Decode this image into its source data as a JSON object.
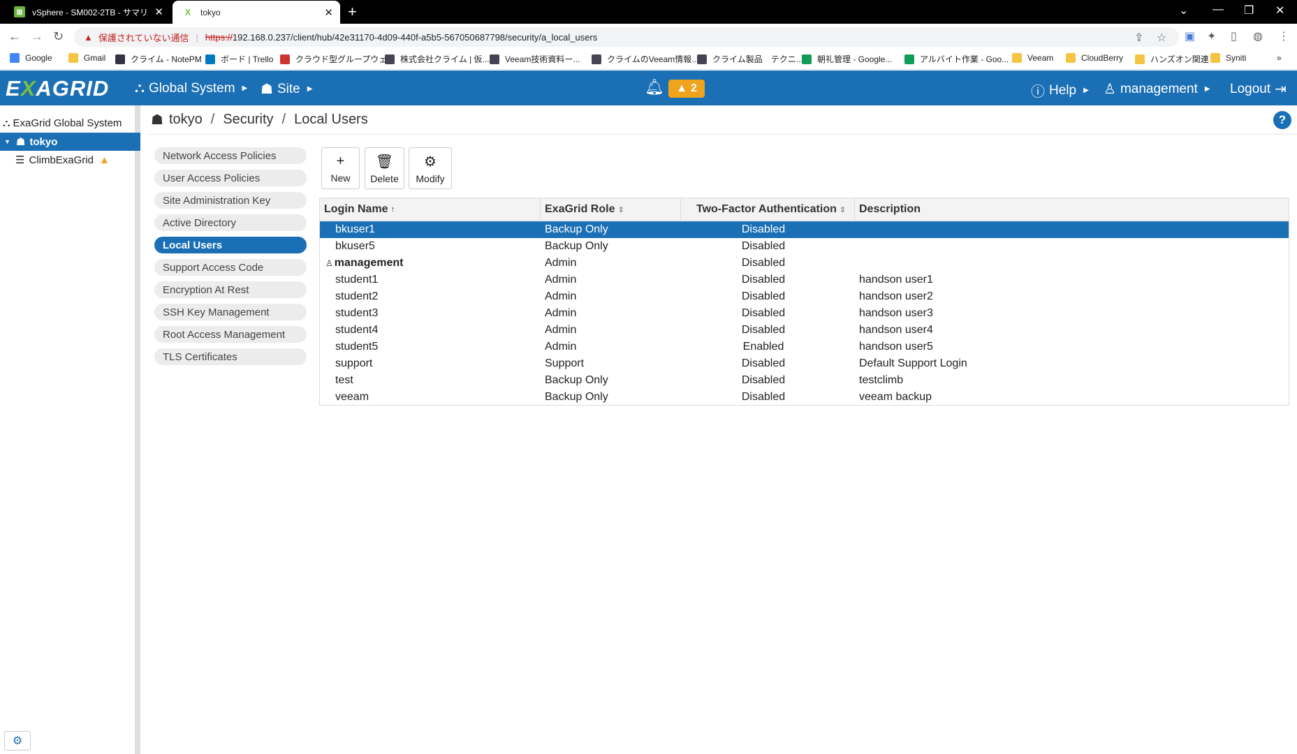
{
  "browser": {
    "tabs": [
      {
        "title": "vSphere - SM002-2TB - サマリ"
      },
      {
        "title": "tokyo"
      }
    ],
    "address": {
      "insecure_label": "保護されていない通信",
      "scheme": "https://",
      "url_rest": "192.168.0.237/client/hub/42e31170-4d09-440f-a5b5-567050687798/security/a_local_users"
    },
    "bookmarks": [
      {
        "label": "Google",
        "color": "#4285f4"
      },
      {
        "label": "Gmail",
        "color": "#f4c542"
      },
      {
        "label": "クライム - NotePM",
        "color": "#334"
      },
      {
        "label": "ボード | Trello",
        "color": "#0079bf"
      },
      {
        "label": "クラウド型グループウェ...",
        "color": "#c33"
      },
      {
        "label": "株式会社クライム | 仮...",
        "color": "#445"
      },
      {
        "label": "Veeam技術資料ー...",
        "color": "#445"
      },
      {
        "label": "クライムのVeeam情報...",
        "color": "#445"
      },
      {
        "label": "クライム製品　テクニ...",
        "color": "#445"
      },
      {
        "label": "朝礼管理 - Google...",
        "color": "#0f9d58"
      },
      {
        "label": "アルバイト作業 - Goo...",
        "color": "#0f9d58"
      },
      {
        "label": "Veeam",
        "color": "#f4c542"
      },
      {
        "label": "CloudBerry",
        "color": "#f4c542"
      },
      {
        "label": "ハンズオン関連",
        "color": "#f4c542"
      },
      {
        "label": "Syniti",
        "color": "#f4c542"
      }
    ]
  },
  "header": {
    "logo": "EXAGRID",
    "global_system": "Global System",
    "site": "Site",
    "alert_count": "2",
    "help": "Help",
    "user": "management",
    "logout": "Logout"
  },
  "tree": {
    "root": "ExaGrid Global System",
    "site": "tokyo",
    "appliance": "ClimbExaGrid"
  },
  "breadcrumb": {
    "site": "tokyo",
    "section": "Security",
    "page": "Local Users"
  },
  "submenu": [
    "Network Access Policies",
    "User Access Policies",
    "Site Administration Key",
    "Active Directory",
    "Local Users",
    "Support Access Code",
    "Encryption At Rest",
    "SSH Key Management",
    "Root Access Management",
    "TLS Certificates"
  ],
  "toolbar": {
    "new_label": "New",
    "delete_label": "Delete",
    "modify_label": "Modify"
  },
  "table": {
    "columns": [
      "Login Name",
      "ExaGrid Role",
      "Two-Factor Authentication",
      "Description"
    ],
    "rows": [
      {
        "login": "bkuser1",
        "role": "Backup Only",
        "tfa": "Disabled",
        "desc": ""
      },
      {
        "login": "bkuser5",
        "role": "Backup Only",
        "tfa": "Disabled",
        "desc": ""
      },
      {
        "login": "management",
        "role": "Admin",
        "tfa": "Disabled",
        "desc": ""
      },
      {
        "login": "student1",
        "role": "Admin",
        "tfa": "Disabled",
        "desc": "handson user1"
      },
      {
        "login": "student2",
        "role": "Admin",
        "tfa": "Disabled",
        "desc": "handson user2"
      },
      {
        "login": "student3",
        "role": "Admin",
        "tfa": "Disabled",
        "desc": "handson user3"
      },
      {
        "login": "student4",
        "role": "Admin",
        "tfa": "Disabled",
        "desc": "handson user4"
      },
      {
        "login": "student5",
        "role": "Admin",
        "tfa": "Enabled",
        "desc": "handson user5"
      },
      {
        "login": "support",
        "role": "Support",
        "tfa": "Disabled",
        "desc": "Default Support Login"
      },
      {
        "login": "test",
        "role": "Backup Only",
        "tfa": "Disabled",
        "desc": "testclimb"
      },
      {
        "login": "veeam",
        "role": "Backup Only",
        "tfa": "Disabled",
        "desc": "veeam backup"
      }
    ]
  },
  "colors": {
    "brand_blue": "#1a6fb5",
    "logo_green": "#76c043",
    "alert_orange": "#f0a31c"
  }
}
